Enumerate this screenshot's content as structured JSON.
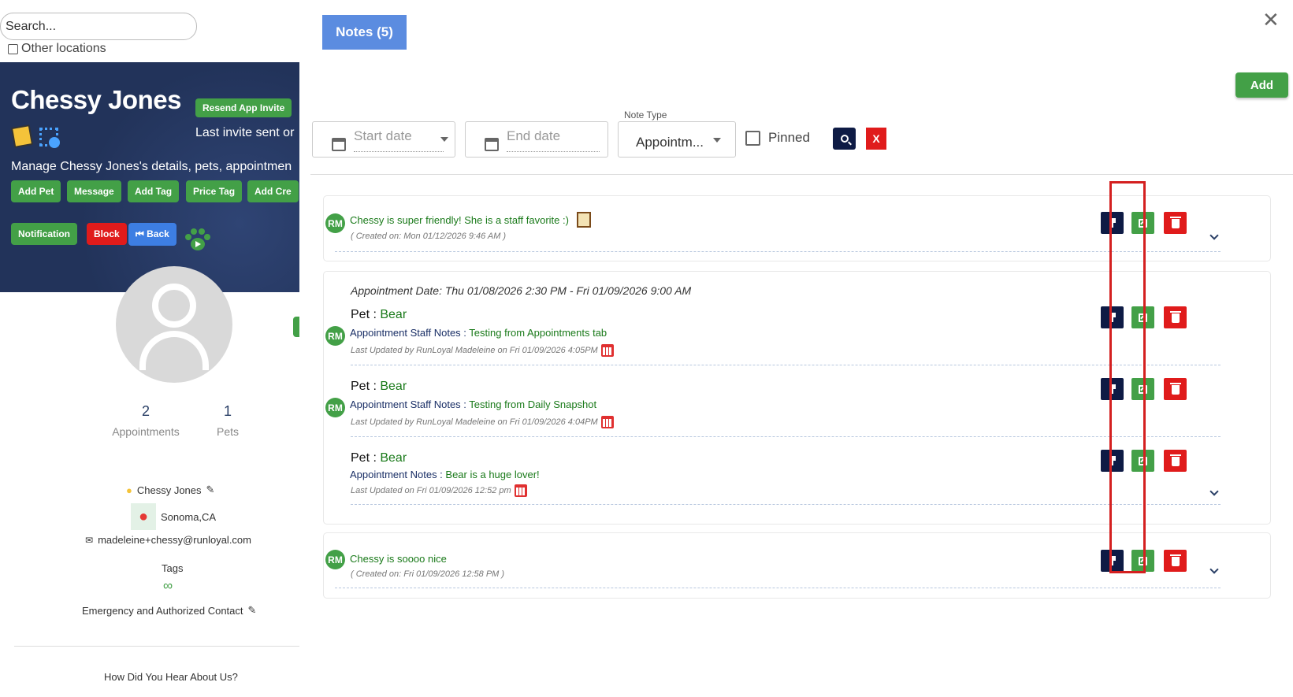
{
  "left_panel": {
    "search_placeholder": "Search...",
    "other_locations_label": "Other locations",
    "client_name": "Chessy Jones",
    "resend_invite_label": "Resend App Invite",
    "last_invite_text": "Last invite sent or",
    "manage_text": "Manage Chessy Jones's details, pets, appointmen",
    "action_buttons": [
      "Add Pet",
      "Message",
      "Add Tag",
      "Price Tag",
      "Add Cre"
    ],
    "notification_label": "Notification",
    "block_label": "Block",
    "back_label": "⏮ Back",
    "stats": [
      {
        "value": "2",
        "label": "Appointments"
      },
      {
        "value": "1",
        "label": "Pets"
      }
    ],
    "contact_name": "Chessy Jones",
    "location": "Sonoma,CA",
    "email": "madeleine+chessy@runloyal.com",
    "tags_label": "Tags",
    "emergency_label": "Emergency and Authorized Contact",
    "hear_label": "How Did You Hear About Us?"
  },
  "modal": {
    "notes_tab_label": "Notes (5)",
    "close_label": "✕",
    "add_label": "Add",
    "filters": {
      "start_date_placeholder": "Start date",
      "end_date_placeholder": "End date",
      "note_type_label": "Note Type",
      "note_type_value": "Appointm...",
      "pinned_label": "Pinned",
      "clear_label": "X"
    },
    "notes": [
      {
        "avatar": "RM",
        "text": "Chessy is super friendly! She is a staff favorite :)",
        "meta": "( Created on: Mon 01/12/2026 9:46 AM )"
      },
      {
        "appointment_date": "Appointment Date: Thu 01/08/2026 2:30 PM - Fri 01/09/2026 9:00 AM",
        "entries": [
          {
            "avatar": "RM",
            "pet_label": "Pet : ",
            "pet_name": "Bear",
            "field_label": "Appointment Staff Notes : ",
            "field_value": "Testing from Appointments tab",
            "meta": "Last Updated by RunLoyal Madeleine on Fri 01/09/2026 4:05PM"
          },
          {
            "avatar": "RM",
            "pet_label": "Pet : ",
            "pet_name": "Bear",
            "field_label": "Appointment Staff Notes : ",
            "field_value": "Testing from Daily Snapshot",
            "meta": "Last Updated by RunLoyal Madeleine on Fri 01/09/2026 4:04PM"
          },
          {
            "pet_label": "Pet : ",
            "pet_name": "Bear",
            "field_label": "Appointment Notes : ",
            "field_value": "Bear is a huge lover!",
            "meta": "Last Updated on Fri 01/09/2026 12:52 pm"
          }
        ]
      },
      {
        "avatar": "RM",
        "text": "Chessy is soooo nice",
        "meta": "( Created on: Fri 01/09/2026 12:58 PM )"
      }
    ]
  },
  "colors": {
    "green": "#43a047",
    "navy": "#0e1b45",
    "red": "#e01b1b",
    "tab_blue": "#5b8ce0",
    "highlight_red": "#d42020"
  }
}
